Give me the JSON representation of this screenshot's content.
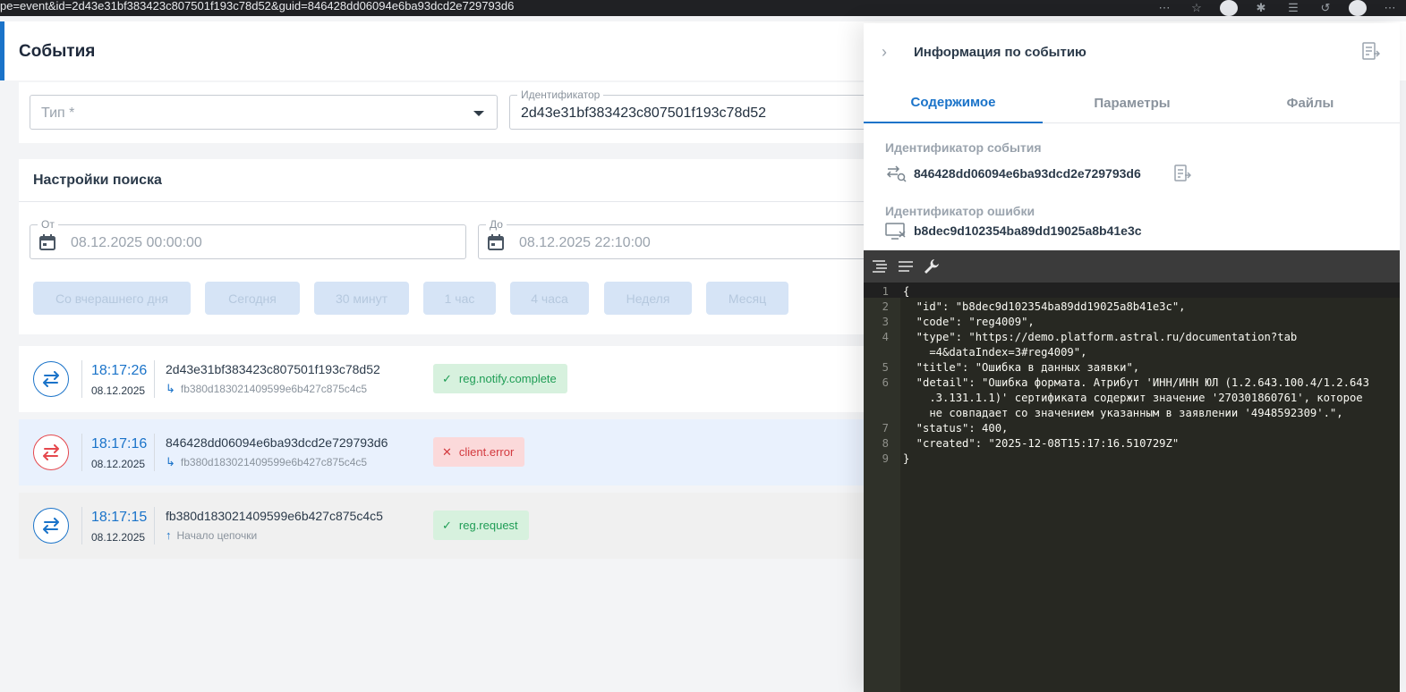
{
  "browser": {
    "url": "pe=event&id=2d43e31bf383423c807501f193c78d52&guid=846428dd06094e6ba93dcd2e729793d6",
    "icons": [
      "more-icon",
      "star-icon",
      "extension-avatar-icon",
      "puzzle-icon",
      "favorites-icon",
      "history-icon",
      "profile-avatar",
      "menu-dots-icon"
    ]
  },
  "page": {
    "title": "События",
    "filters": {
      "type_placeholder": "Тип *",
      "id_label": "Идентификатор",
      "id_value": "2d43e31bf383423c807501f193c78d52"
    },
    "search": {
      "title": "Настройки поиска",
      "from_label": "От",
      "from_value": "08.12.2025 00:00:00",
      "to_label": "До",
      "to_value": "08.12.2025 22:10:00",
      "presets": [
        "Со вчерашнего дня",
        "Сегодня",
        "30 минут",
        "1 час",
        "4 часа",
        "Неделя",
        "Месяц"
      ]
    },
    "events": [
      {
        "time": "18:17:26",
        "date": "08.12.2025",
        "id": "2d43e31bf383423c807501f193c78d52",
        "parent": "fb380d183021409599e6b427c875c4c5",
        "badge": "reg.notify.complete",
        "status": "ok"
      },
      {
        "time": "18:17:16",
        "date": "08.12.2025",
        "id": "846428dd06094e6ba93dcd2e729793d6",
        "parent": "fb380d183021409599e6b427c875c4c5",
        "badge": "client.error",
        "status": "error"
      },
      {
        "time": "18:17:15",
        "date": "08.12.2025",
        "id": "fb380d183021409599e6b427c875c4c5",
        "parent": "Начало цепочки",
        "badge": "reg.request",
        "status": "ok"
      }
    ]
  },
  "panel": {
    "title": "Информация по событию",
    "tabs": [
      "Содержимое",
      "Параметры",
      "Файлы"
    ],
    "active_tab": "Содержимое",
    "event_id_label": "Идентификатор события",
    "event_id": "846428dd06094e6ba93dcd2e729793d6",
    "error_id_label": "Идентификатор ошибки",
    "error_id": "b8dec9d102354ba89dd19025a8b41e3c",
    "code_lines": [
      {
        "n": "1",
        "t": "{"
      },
      {
        "n": "2",
        "t": "  \"id\": \"b8dec9d102354ba89dd19025a8b41e3c\","
      },
      {
        "n": "3",
        "t": "  \"code\": \"reg4009\","
      },
      {
        "n": "4",
        "t": "  \"type\": \"https://demo.platform.astral.ru/documentation?tab"
      },
      {
        "n": "",
        "t": "    =4&dataIndex=3#reg4009\","
      },
      {
        "n": "5",
        "t": "  \"title\": \"Ошибка в данных заявки\","
      },
      {
        "n": "6",
        "t": "  \"detail\": \"Ошибка формата. Атрибут 'ИНН/ИНН ЮЛ (1.2.643.100.4/1.2.643"
      },
      {
        "n": "",
        "t": "    .3.131.1.1)' сертификата содержит значение '270301860761', которое"
      },
      {
        "n": "",
        "t": "    не совпадает со значением указанным в заявлении '4948592309'.\","
      },
      {
        "n": "7",
        "t": "  \"status\": 400,"
      },
      {
        "n": "8",
        "t": "  \"created\": \"2025-12-08T15:17:16.510729Z\""
      },
      {
        "n": "9",
        "t": "}"
      }
    ]
  },
  "colors": {
    "accent": "#1a73c9",
    "success_bg": "#d7f1de",
    "success_fg": "#1f9d55",
    "error_bg": "#fbd9da",
    "error_fg": "#d33a3f",
    "editor_bg": "#272822"
  }
}
